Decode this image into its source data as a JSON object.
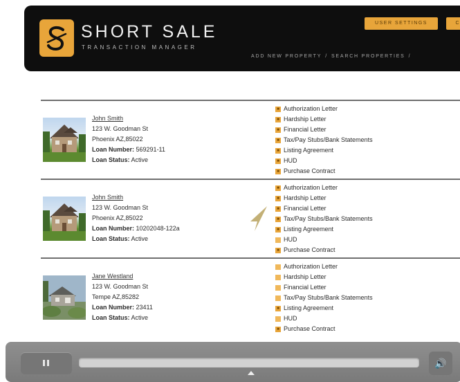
{
  "brand": {
    "title": "SHORT SALE",
    "subtitle": "TRANSACTION MANAGER",
    "logo_icon": "s-signature-icon",
    "accent_color": "#e8a53a"
  },
  "header": {
    "buttons": [
      "USER SETTINGS",
      "CH"
    ],
    "nav": [
      "ADD NEW PROPERTY",
      "SEARCH PROPERTIES",
      "/"
    ]
  },
  "properties": [
    {
      "name": "John Smith",
      "address": "123 W. Goodman St",
      "city": "Phoenix AZ,85022",
      "loan_number_label": "Loan Number:",
      "loan_number": "569291-11",
      "loan_status_label": "Loan Status:",
      "loan_status": "Active",
      "image_icon": "house-photo",
      "documents": [
        "Authorization Letter",
        "Hardship Letter",
        "Financial Letter",
        "Tax/Pay Stubs/Bank Statements",
        "Listing Agreement",
        "HUD",
        "Purchase Contract"
      ]
    },
    {
      "name": "John Smith",
      "address": "123 W. Goodman St",
      "city": "Phoenix AZ,85022",
      "loan_number_label": "Loan Number:",
      "loan_number": "10202048-122a",
      "loan_status_label": "Loan Status:",
      "loan_status": "Active",
      "image_icon": "house-photo",
      "documents": [
        "Authorization Letter",
        "Hardship Letter",
        "Financial Letter",
        "Tax/Pay Stubs/Bank Statements",
        "Listing Agreement",
        "HUD",
        "Purchase Contract"
      ]
    },
    {
      "name": "Jane Westland",
      "address": "123 W. Goodman St",
      "city": "Tempe AZ,85282",
      "loan_number_label": "Loan Number:",
      "loan_number": "23411",
      "loan_status_label": "Loan Status:",
      "loan_status": "Active",
      "image_icon": "house-photo",
      "documents": [
        "Authorization Letter",
        "Hardship Letter",
        "Financial Letter",
        "Tax/Pay Stubs/Bank Statements",
        "Listing Agreement",
        "HUD",
        "Purchase Contract"
      ]
    }
  ],
  "player": {
    "pause_icon": "pause-icon",
    "volume_icon": "speaker-icon",
    "scrubber_icon": "playhead-icon"
  }
}
